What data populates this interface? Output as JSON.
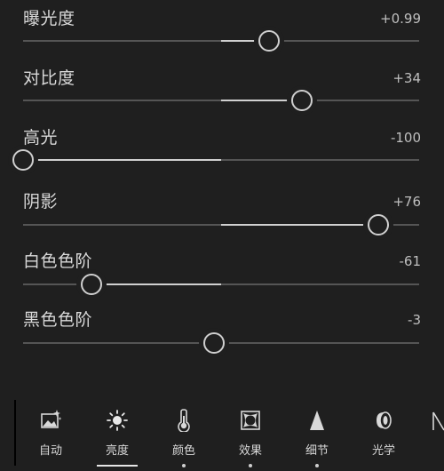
{
  "adjustments": [
    {
      "label": "曝光度",
      "value_text": "+0.99",
      "level": 0.622,
      "fill_to_center": true
    },
    {
      "label": "对比度",
      "value_text": "+34",
      "level": 0.705,
      "fill_to_center": true
    },
    {
      "label": "高光",
      "value_text": "-100",
      "level": 0.0,
      "fill_to_center": true
    },
    {
      "label": "阴影",
      "value_text": "+76",
      "level": 0.897,
      "fill_to_center": true
    },
    {
      "label": "白色色阶",
      "value_text": "-61",
      "level": 0.173,
      "fill_to_center": true
    },
    {
      "label": "黑色色阶",
      "value_text": "-3",
      "level": 0.482,
      "fill_to_center": false
    }
  ],
  "nav": {
    "items": [
      {
        "label": "自动",
        "icon": "auto-icon"
      },
      {
        "label": "亮度",
        "icon": "light-icon"
      },
      {
        "label": "颜色",
        "icon": "color-icon"
      },
      {
        "label": "效果",
        "icon": "effects-icon"
      },
      {
        "label": "细节",
        "icon": "detail-icon"
      },
      {
        "label": "光学",
        "icon": "optics-icon"
      }
    ],
    "selected": 1
  }
}
